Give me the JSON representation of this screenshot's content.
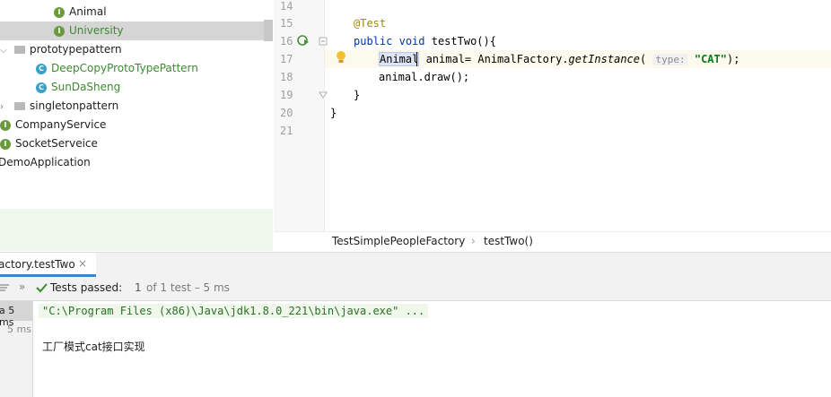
{
  "project_tree": {
    "items": [
      {
        "label": "Animal",
        "badge": "I"
      },
      {
        "label": "University",
        "badge": "I"
      },
      {
        "label": "prototypepattern"
      },
      {
        "label": "DeepCopyProtoTypePattern",
        "badge": "C"
      },
      {
        "label": "SunDaSheng",
        "badge": "C"
      },
      {
        "label": "singletonpattern"
      },
      {
        "label": "CompanyService",
        "badge": "I"
      },
      {
        "label": "SocketServeice",
        "badge": "I"
      },
      {
        "label": "DemoApplication"
      }
    ]
  },
  "editor": {
    "line_numbers": [
      "14",
      "15",
      "16",
      "17",
      "18",
      "19",
      "20",
      "21"
    ],
    "code": {
      "annotation": "@Test",
      "kw_public": "public",
      "kw_void": "void",
      "method_decl": " testTwo(){",
      "type_ident": "Animal",
      "decl_mid": " animal= AnimalFactory.",
      "call_name": "getInstance",
      "open_paren": "(",
      "param_hint": "type:",
      "string_arg": "\"CAT\"",
      "close": ");",
      "draw_line": "animal.draw();",
      "close_inner": "}",
      "close_outer": "}"
    },
    "breadcrumbs": {
      "class": "TestSimplePeopleFactory",
      "method": "testTwo()"
    }
  },
  "run_panel": {
    "tab_label": "actory.testTwo",
    "tab_close": "×",
    "toolbar": {
      "status_label": "Tests passed:",
      "count": "1",
      "summary": "of 1 test – 5 ms",
      "expand_icon": "»"
    },
    "left": {
      "row1": "a 5 ms",
      "row2": "5 ms"
    },
    "console": {
      "command": "\"C:\\Program Files (x86)\\Java\\jdk1.8.0_221\\bin\\java.exe\" ...",
      "output": "工厂模式cat接口实现"
    }
  },
  "colors": {
    "accent_green": "#3c8a2e",
    "selection": "#d5d5d5",
    "keyword": "#0033b3"
  }
}
